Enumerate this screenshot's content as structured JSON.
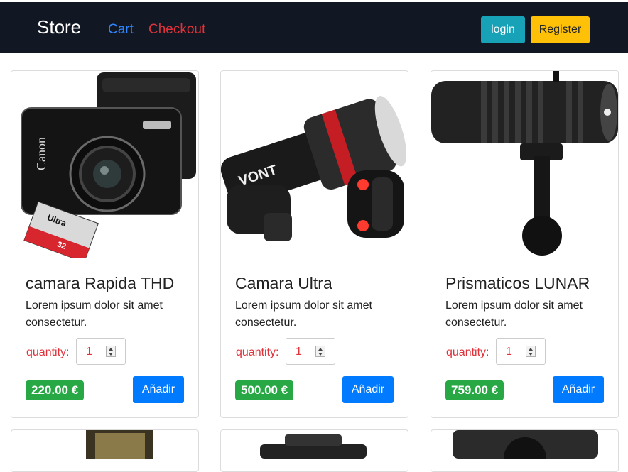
{
  "navbar": {
    "brand": "Store",
    "links": {
      "cart": "Cart",
      "checkout": "Checkout"
    },
    "login_label": "login",
    "register_label": "Register"
  },
  "products": [
    {
      "title": "camara Rapida THD",
      "description": "Lorem ipsum dolor sit amet consectetur.",
      "quantity_label": "quantity:",
      "quantity": "1",
      "price": "220.00 €",
      "add_label": "Añadir"
    },
    {
      "title": "Camara Ultra",
      "description": "Lorem ipsum dolor sit amet consectetur.",
      "quantity_label": "quantity:",
      "quantity": "1",
      "price": "500.00 €",
      "add_label": "Añadir"
    },
    {
      "title": "Prismaticos LUNAR",
      "description": "Lorem ipsum dolor sit amet consectetur.",
      "quantity_label": "quantity:",
      "quantity": "1",
      "price": "759.00 €",
      "add_label": "Añadir"
    }
  ],
  "colors": {
    "navbar_bg": "#111823",
    "login_btn": "#17a2b8",
    "register_btn": "#ffc107",
    "price_badge": "#28a745",
    "add_btn": "#007bff",
    "accent_red": "#e0323b"
  }
}
